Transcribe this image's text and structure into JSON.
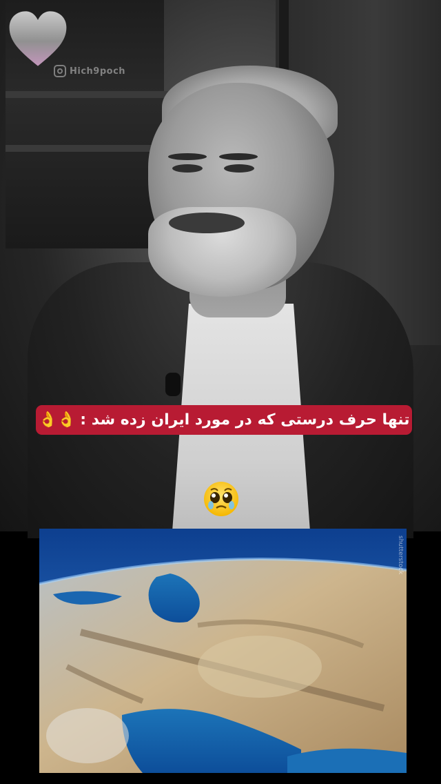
{
  "watermark": {
    "handle": "Hich9poch",
    "icon": "instagram-icon"
  },
  "caption": {
    "text": "تنها حرف درستی که در مورد ایران زده شد :",
    "emoji": "👌👌",
    "background_color": "#b81b33"
  },
  "reaction_emoji": "pleading-face-icon",
  "map": {
    "credit": "shutterstock"
  }
}
